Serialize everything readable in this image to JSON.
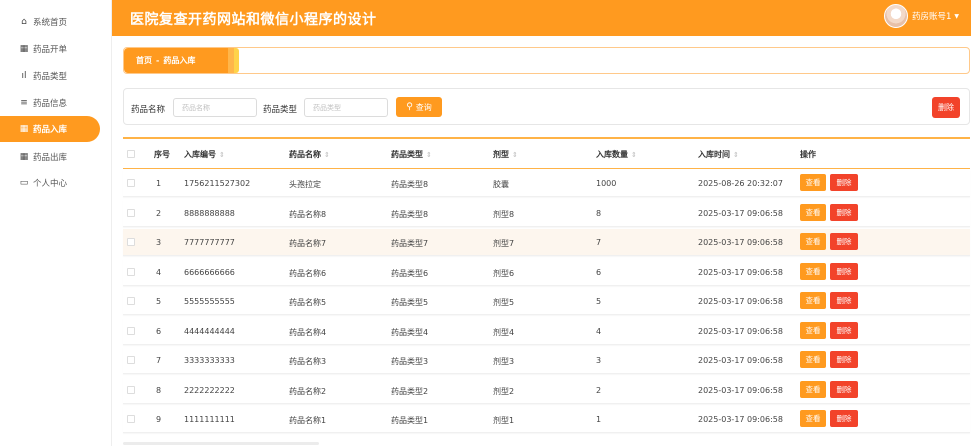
{
  "sidebar": {
    "items": [
      {
        "label": "系统首页",
        "icon": "home-icon",
        "glyph": "⌂"
      },
      {
        "label": "药品开单",
        "icon": "grid-icon",
        "glyph": "▦"
      },
      {
        "label": "药品类型",
        "icon": "bar-chart-icon",
        "glyph": "ıl"
      },
      {
        "label": "药品信息",
        "icon": "list-icon",
        "glyph": "≡"
      },
      {
        "label": "药品入库",
        "icon": "grid-icon",
        "glyph": "▦",
        "active": true
      },
      {
        "label": "药品出库",
        "icon": "grid-icon",
        "glyph": "▦"
      },
      {
        "label": "个人中心",
        "icon": "card-icon",
        "glyph": "▭"
      }
    ]
  },
  "header": {
    "title": "医院复查开药网站和微信小程序的设计",
    "user": "药房账号1",
    "caret": "▼",
    "accent": "#ff9a1f"
  },
  "breadcrumb": {
    "home": "首页",
    "sep": "-",
    "current": "药品入库"
  },
  "search": {
    "name_label": "药品名称",
    "name_placeholder": "药品名称",
    "type_label": "药品类型",
    "type_placeholder": "药品类型",
    "query_label": "查询",
    "query_icon": "⚲",
    "delete_label": "删除"
  },
  "table": {
    "columns": [
      "序号",
      "入库编号",
      "药品名称",
      "药品类型",
      "剂型",
      "入库数量",
      "入库时间",
      "操作"
    ],
    "sort_glyph": "⇕",
    "view_label": "查看",
    "delete_label": "删除",
    "rows": [
      {
        "idx": "1",
        "code": "1756211527302",
        "name": "头孢拉定",
        "type": "药品类型8",
        "form": "胶囊",
        "qty": "1000",
        "time": "2025-08-26 20:32:07"
      },
      {
        "idx": "2",
        "code": "8888888888",
        "name": "药品名称8",
        "type": "药品类型8",
        "form": "剂型8",
        "qty": "8",
        "time": "2025-03-17 09:06:58"
      },
      {
        "idx": "3",
        "code": "7777777777",
        "name": "药品名称7",
        "type": "药品类型7",
        "form": "剂型7",
        "qty": "7",
        "time": "2025-03-17 09:06:58",
        "highlight": true
      },
      {
        "idx": "4",
        "code": "6666666666",
        "name": "药品名称6",
        "type": "药品类型6",
        "form": "剂型6",
        "qty": "6",
        "time": "2025-03-17 09:06:58"
      },
      {
        "idx": "5",
        "code": "5555555555",
        "name": "药品名称5",
        "type": "药品类型5",
        "form": "剂型5",
        "qty": "5",
        "time": "2025-03-17 09:06:58"
      },
      {
        "idx": "6",
        "code": "4444444444",
        "name": "药品名称4",
        "type": "药品类型4",
        "form": "剂型4",
        "qty": "4",
        "time": "2025-03-17 09:06:58"
      },
      {
        "idx": "7",
        "code": "3333333333",
        "name": "药品名称3",
        "type": "药品类型3",
        "form": "剂型3",
        "qty": "3",
        "time": "2025-03-17 09:06:58"
      },
      {
        "idx": "8",
        "code": "2222222222",
        "name": "药品名称2",
        "type": "药品类型2",
        "form": "剂型2",
        "qty": "2",
        "time": "2025-03-17 09:06:58"
      },
      {
        "idx": "9",
        "code": "1111111111",
        "name": "药品名称1",
        "type": "药品类型1",
        "form": "剂型1",
        "qty": "1",
        "time": "2025-03-17 09:06:58"
      }
    ]
  }
}
